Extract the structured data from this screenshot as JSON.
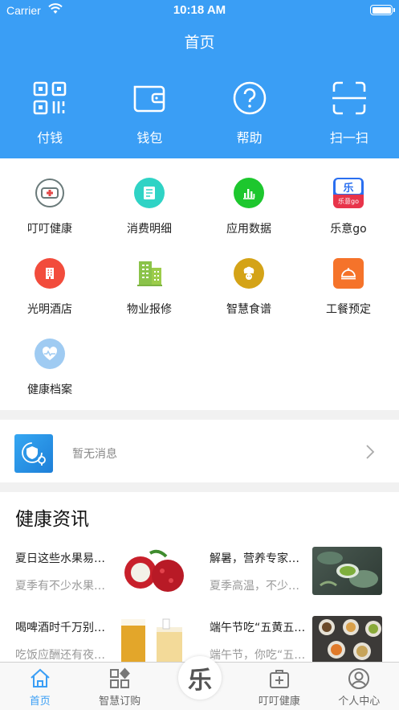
{
  "status": {
    "carrier": "Carrier",
    "time": "10:18 AM"
  },
  "header": {
    "title": "首页"
  },
  "quick_actions": [
    {
      "label": "付钱",
      "icon": "qr-code-icon"
    },
    {
      "label": "钱包",
      "icon": "wallet-icon"
    },
    {
      "label": "帮助",
      "icon": "help-icon"
    },
    {
      "label": "扫一扫",
      "icon": "scan-icon"
    }
  ],
  "grid": [
    {
      "label": "叮叮健康",
      "icon": "health-cross-icon"
    },
    {
      "label": "消费明细",
      "icon": "receipt-icon"
    },
    {
      "label": "应用数据",
      "icon": "bar-chart-icon"
    },
    {
      "label": "乐意go",
      "icon": "leyi-go-icon"
    },
    {
      "label": "光明酒店",
      "icon": "hotel-icon"
    },
    {
      "label": "物业报修",
      "icon": "building-icon"
    },
    {
      "label": "智慧食谱",
      "icon": "chef-icon"
    },
    {
      "label": "工餐预定",
      "icon": "meal-cloche-icon"
    },
    {
      "label": "健康档案",
      "icon": "heart-pulse-icon"
    }
  ],
  "leyi_logo_text": "乐意go",
  "notice": {
    "text": "暂无消息"
  },
  "news": {
    "title": "健康资讯",
    "items": [
      {
        "headline": "夏日这些水果易…",
        "summary": "夏季有不少水果…",
        "image": "lychee-photo"
      },
      {
        "headline": "解暑，营养专家…",
        "summary": "夏季高温，不少…",
        "image": "green-tea-photo"
      },
      {
        "headline": "喝啤酒时千万别…",
        "summary": "吃饭应酬还有夜…",
        "image": "beer-photo"
      },
      {
        "headline": "端午节吃“五黄五…",
        "summary": "端午节，你吃“五…",
        "image": "dishes-photo"
      }
    ]
  },
  "tabs": [
    {
      "label": "首页",
      "icon": "home-icon",
      "active": true
    },
    {
      "label": "智慧订购",
      "icon": "order-grid-icon",
      "active": false
    },
    {
      "label": "叮叮健康",
      "icon": "health-kit-icon",
      "active": false
    },
    {
      "label": "个人中心",
      "icon": "user-icon",
      "active": false
    }
  ],
  "center_tab": {
    "glyph": "乐"
  },
  "colors": {
    "primary": "#3a9ef5",
    "background": "#f1f1f1"
  }
}
